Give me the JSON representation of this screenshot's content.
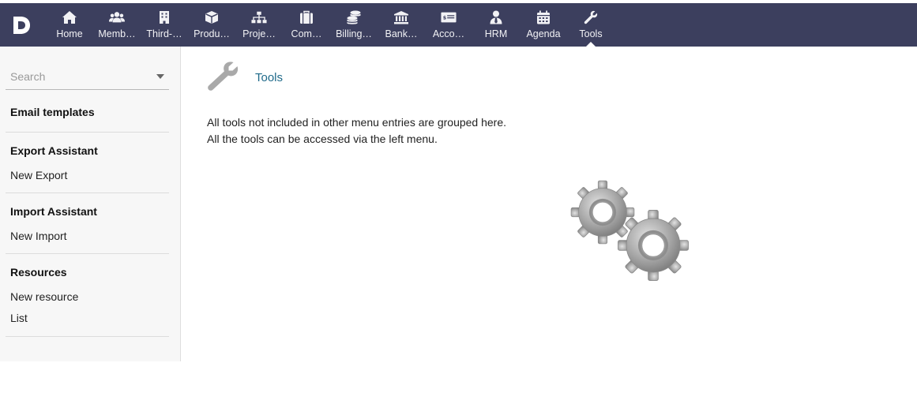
{
  "topbar": {
    "logo_letter": "D",
    "items": [
      {
        "label": "Home",
        "icon": "home-icon"
      },
      {
        "label": "Memb…",
        "icon": "users-icon"
      },
      {
        "label": "Third-…",
        "icon": "building-icon"
      },
      {
        "label": "Produ…",
        "icon": "cube-icon"
      },
      {
        "label": "Proje…",
        "icon": "sitemap-icon"
      },
      {
        "label": "Com…",
        "icon": "suitcase-icon"
      },
      {
        "label": "Billing…",
        "icon": "coins-icon"
      },
      {
        "label": "Bank…",
        "icon": "bank-icon"
      },
      {
        "label": "Acco…",
        "icon": "money-check-icon"
      },
      {
        "label": "HRM",
        "icon": "user-tie-icon"
      },
      {
        "label": "Agenda",
        "icon": "calendar-icon"
      },
      {
        "label": "Tools",
        "icon": "wrench-icon",
        "active": true
      }
    ],
    "background_color": "#3c3f5e"
  },
  "sidebar": {
    "search": {
      "placeholder": "Search",
      "value": ""
    },
    "sections": [
      {
        "title": "Email templates",
        "links": []
      },
      {
        "title": "Export Assistant",
        "links": [
          "New Export"
        ]
      },
      {
        "title": "Import Assistant",
        "links": [
          "New Import"
        ]
      },
      {
        "title": "Resources",
        "links": [
          "New resource",
          "List"
        ]
      }
    ]
  },
  "main": {
    "title": "Tools",
    "title_color": "#1f6a8a",
    "description_lines": [
      "All tools not included in other menu entries are grouped here.",
      "All the tools can be accessed via the left menu."
    ],
    "illustration": "gears-icon"
  }
}
